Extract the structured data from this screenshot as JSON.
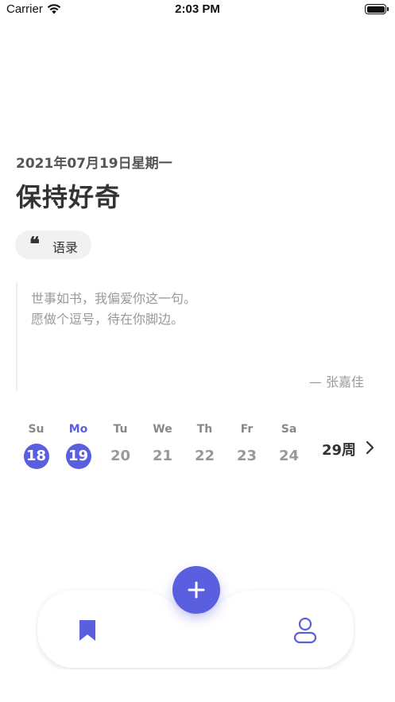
{
  "status_bar": {
    "carrier": "Carrier",
    "time": "2:03 PM",
    "wifi_icon": "wifi-icon",
    "battery_icon": "battery-icon"
  },
  "header": {
    "date": "2021年07月19日星期一",
    "title": "保持好奇"
  },
  "tag": {
    "icon": "quote-icon",
    "icon_glyph": "❝",
    "label": "语录"
  },
  "quote": {
    "lines": [
      "世事如书，我偏爱你这一句。",
      "愿做个逗号，待在你脚边。"
    ],
    "author": "— 张嘉佳"
  },
  "week": {
    "days": [
      {
        "name": "Su",
        "num": "18",
        "selected": true,
        "today": false
      },
      {
        "name": "Mo",
        "num": "19",
        "selected": true,
        "today": true
      },
      {
        "name": "Tu",
        "num": "20",
        "selected": false,
        "today": false
      },
      {
        "name": "We",
        "num": "21",
        "selected": false,
        "today": false
      },
      {
        "name": "Th",
        "num": "22",
        "selected": false,
        "today": false
      },
      {
        "name": "Fr",
        "num": "23",
        "selected": false,
        "today": false
      },
      {
        "name": "Sa",
        "num": "24",
        "selected": false,
        "today": false
      }
    ],
    "week_label": "29周",
    "next_icon": "chevron-right-icon"
  },
  "tabbar": {
    "left_icon": "bookmark-icon",
    "center_icon": "plus-icon",
    "right_icon": "user-icon"
  },
  "colors": {
    "accent": "#5a5fe0",
    "text_primary": "#333333",
    "text_muted": "#999999",
    "chip_bg": "#f1f1f1"
  }
}
